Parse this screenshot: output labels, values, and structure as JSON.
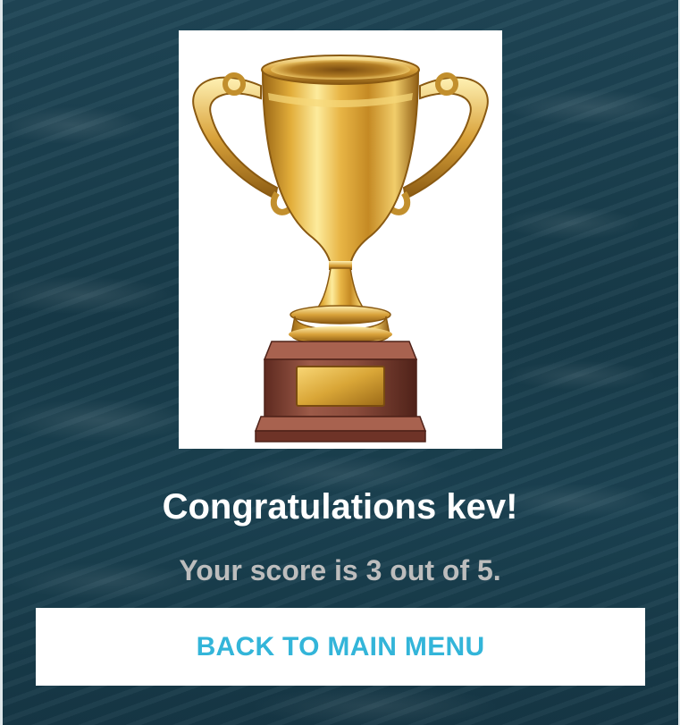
{
  "screen": {
    "background": "ocean-texture-background"
  },
  "trophy": {
    "icon": "trophy-icon",
    "colors": {
      "gold": "#e0b13a",
      "gold_light": "#fbe38a",
      "gold_dark": "#a8741a",
      "base_wood": "#8b4a3c"
    }
  },
  "result": {
    "headline": "Congratulations kev!",
    "score_text": "Your score is 3 out of 5."
  },
  "actions": {
    "back_label": "BACK TO MAIN MENU"
  },
  "colors": {
    "headline": "#ffffff",
    "score": "#bdbdbd",
    "button_bg": "#ffffff",
    "button_text": "#33b5d9"
  }
}
